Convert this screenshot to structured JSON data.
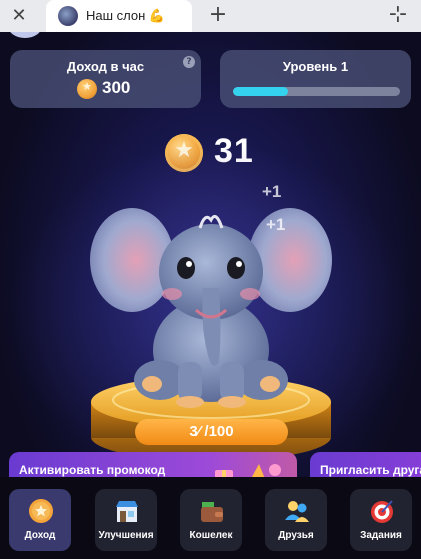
{
  "browser": {
    "tab_title": "Наш слон 💪"
  },
  "header": {
    "income": {
      "title": "Доход в час",
      "value": "300"
    },
    "level": {
      "title": "Уровень 1",
      "progress": 0.33
    }
  },
  "balance": {
    "value": "31"
  },
  "floating": [
    "+1",
    "+1"
  ],
  "energy": {
    "text": "3⁄ /100"
  },
  "banners": {
    "promo": "Активировать промокод",
    "invite": "Пригласить друга"
  },
  "nav": {
    "items": [
      {
        "label": "Доход",
        "icon": "coin-icon"
      },
      {
        "label": "Улучшения",
        "icon": "shop-icon"
      },
      {
        "label": "Кошелек",
        "icon": "wallet-icon"
      },
      {
        "label": "Друзья",
        "icon": "friends-icon"
      },
      {
        "label": "Задания",
        "icon": "target-icon"
      }
    ]
  },
  "colors": {
    "accent": "#35d2ef",
    "coin": "#f3a43a",
    "energy": "#f28a16",
    "banner": "#8a3fd8"
  }
}
